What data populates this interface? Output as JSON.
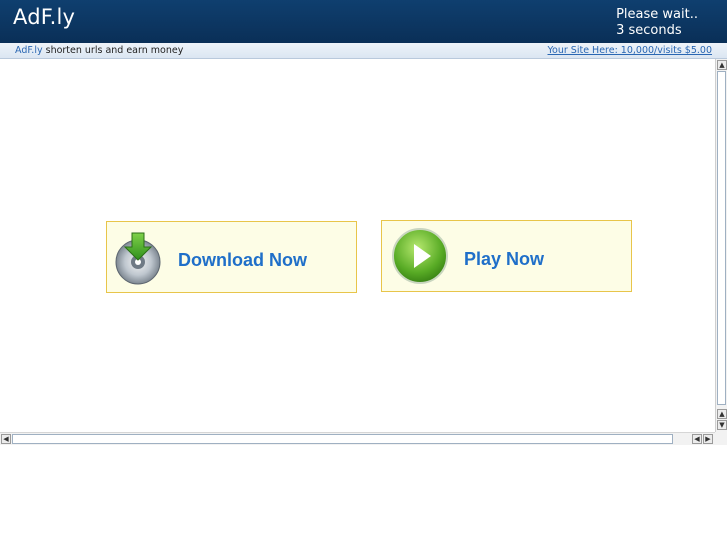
{
  "header": {
    "logo": "AdF.ly",
    "wait_line1": "Please wait..",
    "wait_line2": "3 seconds"
  },
  "subbar": {
    "brand_link": "AdF.ly",
    "tagline": " shorten urls and earn money",
    "promo": "Your Site Here: 10,000/visits $5.00"
  },
  "ads": {
    "download_label": "Download Now",
    "play_label": "Play Now",
    "download_icon": "cd-download-icon",
    "play_icon": "play-circle-icon"
  },
  "colors": {
    "header": "#0f3f6f",
    "link": "#2a67b3",
    "ad_bg": "#fdfde6",
    "ad_border": "#e8c54a",
    "ad_text": "#1f6fc9"
  }
}
